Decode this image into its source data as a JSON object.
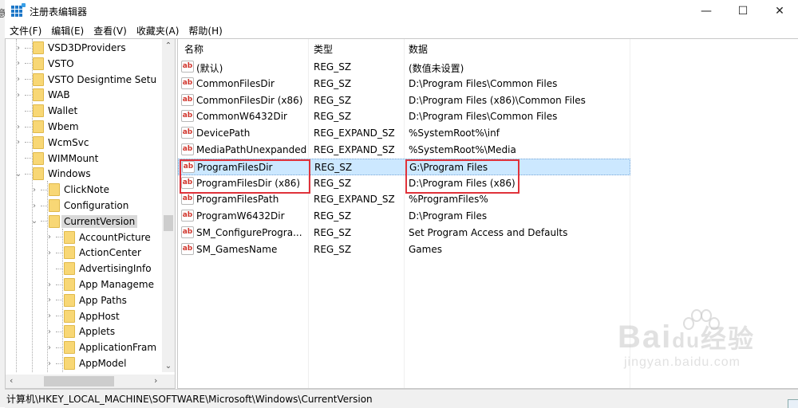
{
  "window": {
    "title": "注册表编辑器",
    "controls": {
      "minimize": "—",
      "maximize": "☐",
      "close": "✕"
    },
    "edge_fragment": "意"
  },
  "menu": [
    "文件(F)",
    "编辑(E)",
    "查看(V)",
    "收藏夹(A)",
    "帮助(H)"
  ],
  "tree": {
    "items": [
      {
        "label": "VSD3DProviders",
        "level": 0,
        "expander": "collapsed"
      },
      {
        "label": "VSTO",
        "level": 0,
        "expander": "collapsed"
      },
      {
        "label": "VSTO Designtime Setu",
        "level": 0,
        "expander": "collapsed"
      },
      {
        "label": "WAB",
        "level": 0,
        "expander": "collapsed"
      },
      {
        "label": "Wallet",
        "level": 0,
        "expander": "none"
      },
      {
        "label": "Wbem",
        "level": 0,
        "expander": "collapsed"
      },
      {
        "label": "WcmSvc",
        "level": 0,
        "expander": "collapsed"
      },
      {
        "label": "WIMMount",
        "level": 0,
        "expander": "none"
      },
      {
        "label": "Windows",
        "level": 0,
        "expander": "expanded"
      },
      {
        "label": "ClickNote",
        "level": 1,
        "expander": "collapsed"
      },
      {
        "label": "Configuration",
        "level": 1,
        "expander": "collapsed"
      },
      {
        "label": "CurrentVersion",
        "level": 1,
        "expander": "expanded",
        "selected": true
      },
      {
        "label": "AccountPicture",
        "level": 2,
        "expander": "collapsed"
      },
      {
        "label": "ActionCenter",
        "level": 2,
        "expander": "collapsed"
      },
      {
        "label": "AdvertisingInfo",
        "level": 2,
        "expander": "none"
      },
      {
        "label": "App Manageme",
        "level": 2,
        "expander": "collapsed"
      },
      {
        "label": "App Paths",
        "level": 2,
        "expander": "collapsed"
      },
      {
        "label": "AppHost",
        "level": 2,
        "expander": "collapsed"
      },
      {
        "label": "Applets",
        "level": 2,
        "expander": "collapsed"
      },
      {
        "label": "ApplicationFram",
        "level": 2,
        "expander": "collapsed"
      },
      {
        "label": "AppModel",
        "level": 2,
        "expander": "collapsed"
      }
    ]
  },
  "list": {
    "columns": [
      "名称",
      "类型",
      "数据"
    ],
    "icon": "ab",
    "rows": [
      {
        "name": "(默认)",
        "type": "REG_SZ",
        "data": "(数值未设置)"
      },
      {
        "name": "CommonFilesDir",
        "type": "REG_SZ",
        "data": "D:\\Program Files\\Common Files"
      },
      {
        "name": "CommonFilesDir (x86)",
        "type": "REG_SZ",
        "data": "D:\\Program Files (x86)\\Common Files"
      },
      {
        "name": "CommonW6432Dir",
        "type": "REG_SZ",
        "data": "D:\\Program Files\\Common Files"
      },
      {
        "name": "DevicePath",
        "type": "REG_EXPAND_SZ",
        "data": "%SystemRoot%\\inf"
      },
      {
        "name": "MediaPathUnexpanded",
        "type": "REG_EXPAND_SZ",
        "data": "%SystemRoot%\\Media"
      },
      {
        "name": "ProgramFilesDir",
        "type": "REG_SZ",
        "data": "G:\\Program Files",
        "selected": true
      },
      {
        "name": "ProgramFilesDir (x86)",
        "type": "REG_SZ",
        "data": "D:\\Program Files (x86)"
      },
      {
        "name": "ProgramFilesPath",
        "type": "REG_EXPAND_SZ",
        "data": "%ProgramFiles%"
      },
      {
        "name": "ProgramW6432Dir",
        "type": "REG_SZ",
        "data": "D:\\Program Files"
      },
      {
        "name": "SM_ConfigureProgra...",
        "type": "REG_SZ",
        "data": "Set Program Access and Defaults"
      },
      {
        "name": "SM_GamesName",
        "type": "REG_SZ",
        "data": "Games"
      }
    ]
  },
  "status": {
    "path": "计算机\\HKEY_LOCAL_MACHINE\\SOFTWARE\\Microsoft\\Windows\\CurrentVersion"
  },
  "watermark": {
    "brand_left": "Bai",
    "brand_mid": "du",
    "brand_right": "经验",
    "url": "jingyan.baidu.com"
  },
  "colors": {
    "selection": "#cce8ff",
    "highlight_box": "#e0323a",
    "value_icon": "#d0352c"
  }
}
